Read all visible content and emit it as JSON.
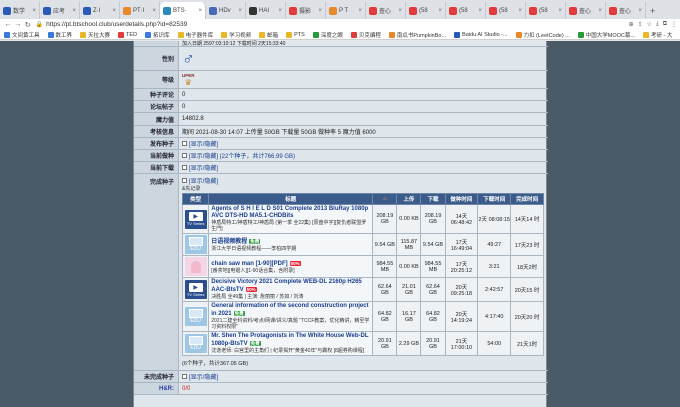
{
  "browser": {
    "tabs": [
      {
        "label": "数学",
        "color": "#2a5ab8"
      },
      {
        "label": "应考",
        "color": "#2a5ab8"
      },
      {
        "label": "Z·I",
        "color": "#2a5ab8"
      },
      {
        "label": "PT·I",
        "color": "#e88a2a"
      },
      {
        "label": "BTS·",
        "color": "#2a8ab8",
        "active": true
      },
      {
        "label": "HDv",
        "color": "#4a6ab8"
      },
      {
        "label": "HAI",
        "color": "#333"
      },
      {
        "label": "摄影",
        "color": "#e23b3b"
      },
      {
        "label": "P T",
        "color": "#e88a2a"
      },
      {
        "label": "查心",
        "color": "#e23b3b"
      },
      {
        "label": "(58",
        "color": "#e23b3b"
      },
      {
        "label": "(58",
        "color": "#e23b3b"
      },
      {
        "label": "(58",
        "color": "#e23b3b"
      },
      {
        "label": "(58",
        "color": "#e23b3b"
      },
      {
        "label": "查心",
        "color": "#e23b3b"
      },
      {
        "label": "查心",
        "color": "#e23b3b"
      }
    ],
    "new_tab": "+",
    "url": "https://pt.btschool.club/userdetails.php?id=82539",
    "bookmarks": [
      {
        "label": "文间黄工具",
        "color": "#3b7ad8"
      },
      {
        "label": "数工界",
        "color": "#3b7ad8"
      },
      {
        "label": "天拉大赛",
        "color": "#e8b82a"
      },
      {
        "label": "TED",
        "color": "#e23b3b"
      },
      {
        "label": "拓识库",
        "color": "#3b7ad8"
      },
      {
        "label": "电子器件库",
        "color": "#e8b82a"
      },
      {
        "label": "学习视频",
        "color": "#e8b82a"
      },
      {
        "label": "邮箱",
        "color": "#e8b82a"
      },
      {
        "label": "PTS",
        "color": "#e8b82a"
      },
      {
        "label": "深度之眼",
        "color": "#2a9a3a"
      },
      {
        "label": "贝克编程",
        "color": "#e23b3b"
      },
      {
        "label": "南瓜书PumpkinBo...",
        "color": "#e88a2a"
      },
      {
        "label": "Baidu AI Studio -...",
        "color": "#2a5ab8"
      },
      {
        "label": "力扣 (LeetCode) ...",
        "color": "#e88a2a"
      },
      {
        "label": "中国大学MOOC慕...",
        "color": "#2a9a3a"
      },
      {
        "label": "考研 - 大",
        "color": "#e8b82a"
      }
    ]
  },
  "profile": {
    "top_line": "加入日期 2597:03:10:12    下载时间 2天15:33:40",
    "gender_label": "性别",
    "gender_symbol": "♂",
    "level_label": "等级",
    "level_value": "UPER",
    "comments_label": "种子评论",
    "comments_value": "0",
    "forum_label": "论坛帖子",
    "forum_value": "0",
    "magic_label": "魔力值",
    "magic_value": "14802.8",
    "exam_label": "考核信息",
    "exam_value": "期间 2021-08-30 14:07  上传量 50GB  下载量 50GB  做种率 5  魔力值 6000",
    "published_label": "发布种子",
    "published_value": "[显示/隐藏]",
    "seeding_label": "当前做种",
    "seeding_value": "[显示/隐藏]  (22个种子，共计766.99 GB)",
    "downloading_label": "当前下载",
    "downloading_value": "[显示/隐藏]",
    "completed_label": "完成种子",
    "completed_value": "[显示/隐藏]",
    "completed_note": "&先记录",
    "unfinished_label": "未完成种子",
    "unfinished_value": "[显示/隐藏]",
    "hr_label": "H&R:",
    "hr_value": "0/0",
    "summary": "(6个种子，共计367.05 GB)"
  },
  "table": {
    "headers": [
      "类型",
      "标题",
      "⌂",
      "上传",
      "下载",
      "做种时间",
      "下载时间",
      "完成时间"
    ],
    "rows": [
      {
        "type": "tv",
        "type_label": "TV Series",
        "title": "Agents of S H I E L D S01 Complete 2013 BluRay 1080p AVC DTS-HD MA5.1-CHDBits",
        "sub": "神盾局特工/神盾特工/神盾局 (第一季 全22集) [原盘中字][复仇者联盟罗生門]",
        "tag": "",
        "size": "208.19 GB",
        "up": "0.00 KB",
        "down": "208.19 GB",
        "seed": "14天 06:48:42",
        "dl": "2天 08:08:15",
        "done": "14天14 时"
      },
      {
        "type": "edu",
        "type_label": "EDU",
        "title": "日语视频教程",
        "sub": "浙江大学日语视频教程——李柏四学期",
        "tag": "免费",
        "size": "9.54 GB",
        "up": "115.87 MB",
        "down": "9.54 GB",
        "seed": "17天 16:49:04",
        "dl": "49:27",
        "done": "17天23 时"
      },
      {
        "type": "anime",
        "type_label": "",
        "title": "chain saw man [1-90][PDF]",
        "sub": "[番茶地][电锯人][1-90话合集，含附录]",
        "tag": "50%",
        "size": "984.55 MB",
        "up": "0.00 KB",
        "down": "984.55 MB",
        "seed": "17天 20:25:12",
        "dl": "3:21",
        "done": "18天2时"
      },
      {
        "type": "tv",
        "type_label": "TV Series",
        "title": "Decisive Victory 2021 Complete WEB-DL 2160p H265 AAC-BtsTV",
        "sub": "决胜局 全49集 | 主演: 詹丽丽 / 苏如 / 刘涛",
        "tag": "50%",
        "size": "62.64 GB",
        "up": "21.01 GB",
        "down": "62.64 GB",
        "seed": "20天 09:25:18",
        "dl": "2:42:57",
        "done": "20天15 时"
      },
      {
        "type": "edu",
        "type_label": "EDU",
        "title": "General information of the second construction project in 2021",
        "sub": "2021二建全科资料/考点/网课/讲义/真题 \"TCCF教案，优化精讲，精至学习资料权限\"",
        "tag": "免费",
        "size": "64.82 GB",
        "up": "16.17 GB",
        "down": "64.82 GB",
        "seed": "20天 14:19:24",
        "dl": "4:17:40",
        "done": "20天20 时"
      },
      {
        "type": "edu",
        "type_label": "EDU",
        "title": "Mr. Shen The Protagonists in The White House Web-DL 1080p-BtsTV",
        "sub": "沈逸老师: 白宫里的主角们 | 纪录揭开\"黄金40年\"与霸权 [8超券购课程]",
        "tag": "免费",
        "size": "20.91 GB",
        "up": "2.29 GB",
        "down": "20.91 GB",
        "seed": "21天 17:00:10",
        "dl": "54:00",
        "done": "21天1时"
      }
    ]
  }
}
